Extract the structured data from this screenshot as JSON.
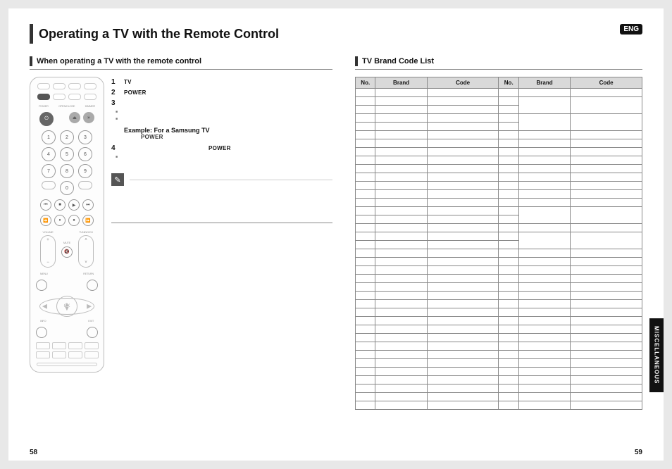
{
  "lang_badge": "ENG",
  "main_title": "Operating a TV with the Remote Control",
  "left": {
    "section_title": "When operating a TV with the remote control",
    "steps": {
      "s1_no": "1",
      "s1_kw": "TV",
      "s2_no": "2",
      "s2_kw": "POWER",
      "s3_no": "3",
      "s4_no": "4",
      "s4_kw": "POWER"
    },
    "example_head": "Example: For a Samsung TV",
    "example_sub_kw": "POWER",
    "remote": {
      "power_label": "POWER",
      "open_label": "OPEN/CLOSE",
      "dimmer_label": "DIMMER",
      "volume_label": "VOLUME",
      "mute_label": "MUTE",
      "tuning_label": "TUNING/CH",
      "menu_label": "MENU",
      "return_label": "RETURN",
      "info_label": "INFO",
      "exit_label": "EXIT",
      "nums": [
        "1",
        "2",
        "3",
        "4",
        "5",
        "6",
        "7",
        "8",
        "9",
        "0"
      ]
    }
  },
  "right": {
    "section_title": "TV Brand Code List",
    "headers": {
      "no": "No.",
      "brand": "Brand",
      "code": "Code"
    }
  },
  "side_tab": "MISCELLANEOUS",
  "page_left": "58",
  "page_right": "59"
}
